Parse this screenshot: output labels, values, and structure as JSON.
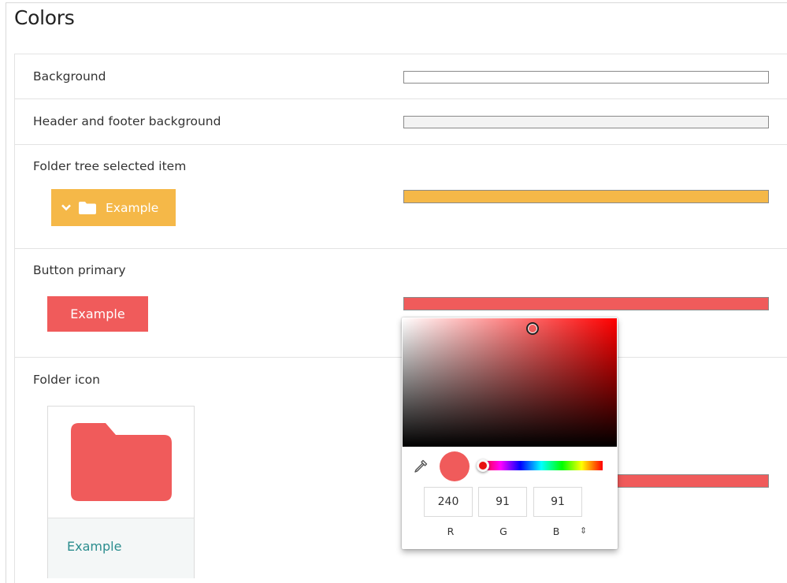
{
  "page": {
    "title": "Colors"
  },
  "rows": {
    "background": {
      "label": "Background",
      "color": "#ffffff"
    },
    "header_footer": {
      "label": "Header and footer background",
      "color": "#f3f3f3"
    },
    "folder_tree": {
      "label": "Folder tree selected item",
      "preview_text": "Example",
      "color": "#f5b848"
    },
    "button_primary": {
      "label": "Button primary",
      "button_text": "Example",
      "color": "#f05b5b"
    },
    "folder_icon": {
      "label": "Folder icon",
      "caption": "Example",
      "color": "#f05b5b"
    }
  },
  "picker": {
    "color": "#f05b5b",
    "hue_color": "#ff0000",
    "channels": [
      {
        "label": "R",
        "value": "240"
      },
      {
        "label": "G",
        "value": "91"
      },
      {
        "label": "B",
        "value": "91"
      }
    ],
    "toggle_glyph": "⇕"
  },
  "icons": {
    "chevron": "chevron-down-icon",
    "folder": "folder-icon",
    "eyedropper": "eyedropper-icon"
  }
}
